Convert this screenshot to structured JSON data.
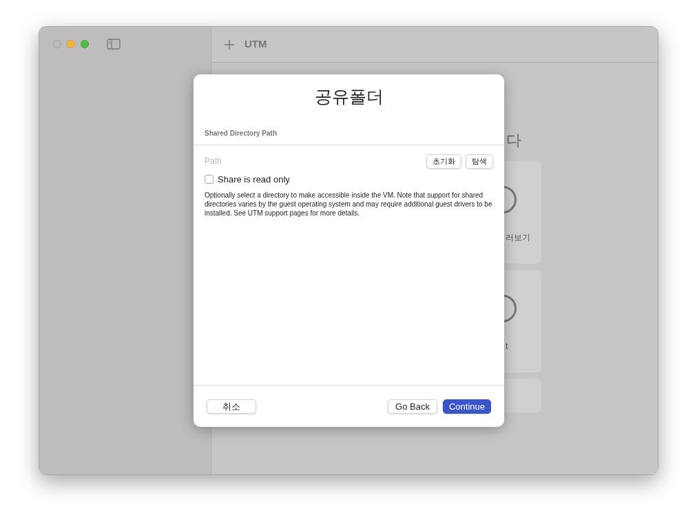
{
  "toolbar": {
    "title": "UTM"
  },
  "background": {
    "heading": "다",
    "cards": [
      {
        "label": "러보기"
      },
      {
        "label": "t"
      }
    ]
  },
  "dialog": {
    "title": "공유폴더",
    "section": "Shared Directory Path",
    "path": {
      "placeholder": "Path"
    },
    "path_buttons": [
      "초기화",
      "탐색"
    ],
    "read_only": {
      "label": "Share is read only",
      "checked": false
    },
    "description": "Optionally select a directory to make accessible inside the VM. Note that support for shared directories varies by the guest operating system and may require additional guest drivers to be installed. See UTM support pages for more details.",
    "buttons": [
      {
        "label": "취소",
        "kind": "cancel"
      },
      {
        "label": "Go Back",
        "kind": "secondary"
      },
      {
        "label": "Continue",
        "kind": "primary"
      }
    ]
  }
}
